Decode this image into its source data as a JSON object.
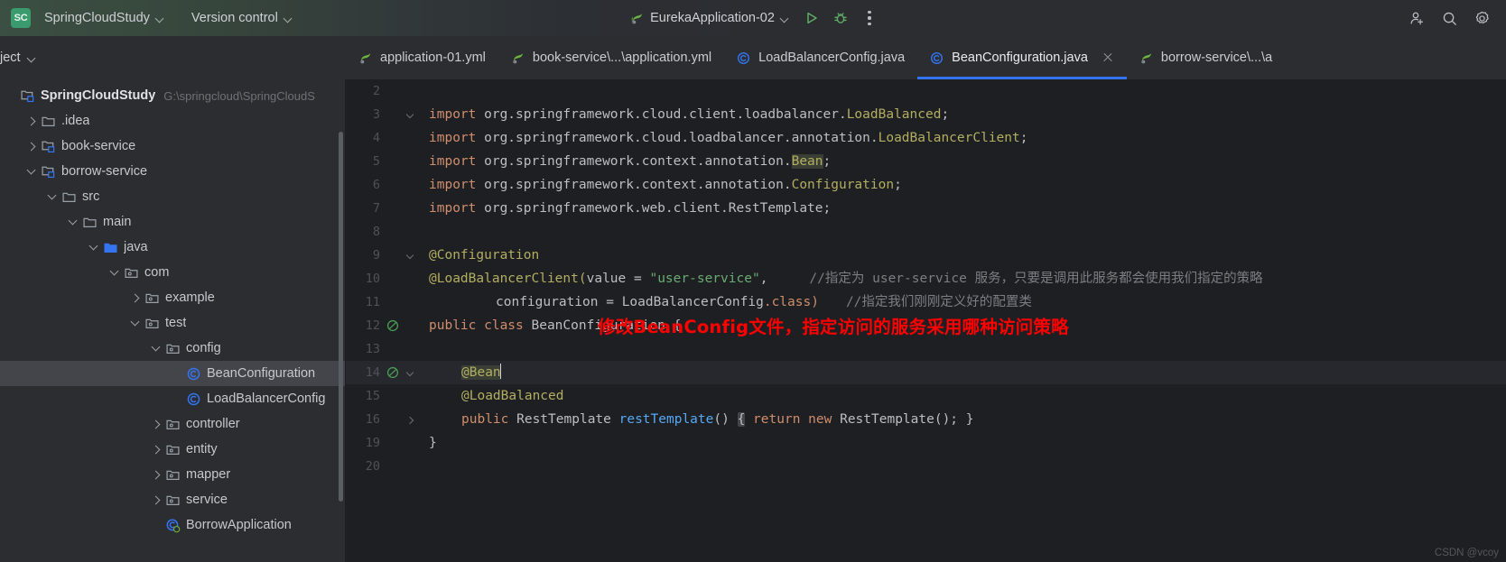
{
  "titlebar": {
    "badge": "SC",
    "project_name": "SpringCloudStudy",
    "version_control": "Version control",
    "run_config": "EurekaApplication-02",
    "icons": {
      "run": "run-icon",
      "debug": "debug-icon",
      "more": "more-options-icon",
      "add_user": "add-user-icon",
      "search": "search-icon",
      "settings": "settings-icon"
    },
    "accent_run": "#5fad65",
    "accent_debug": "#5fad65"
  },
  "sidebar": {
    "header": "ject",
    "tree": [
      {
        "label": "SpringCloudStudy",
        "path": "G:\\springcloud\\SpringCloudS",
        "indent": 0,
        "arrow": "none",
        "icon": "module-folder-icon",
        "root": true,
        "selected": false
      },
      {
        "label": ".idea",
        "path": "",
        "indent": 1,
        "arrow": "right",
        "icon": "folder-icon",
        "root": false,
        "selected": false
      },
      {
        "label": "book-service",
        "path": "",
        "indent": 1,
        "arrow": "right",
        "icon": "module-folder-icon",
        "root": false,
        "selected": false
      },
      {
        "label": "borrow-service",
        "path": "",
        "indent": 1,
        "arrow": "down",
        "icon": "module-folder-icon",
        "root": false,
        "selected": false
      },
      {
        "label": "src",
        "path": "",
        "indent": 2,
        "arrow": "down",
        "icon": "folder-icon",
        "root": false,
        "selected": false
      },
      {
        "label": "main",
        "path": "",
        "indent": 3,
        "arrow": "down",
        "icon": "folder-icon",
        "root": false,
        "selected": false
      },
      {
        "label": "java",
        "path": "",
        "indent": 4,
        "arrow": "down",
        "icon": "source-folder-icon",
        "root": false,
        "selected": false
      },
      {
        "label": "com",
        "path": "",
        "indent": 5,
        "arrow": "down",
        "icon": "package-icon",
        "root": false,
        "selected": false
      },
      {
        "label": "example",
        "path": "",
        "indent": 6,
        "arrow": "right",
        "icon": "package-icon",
        "root": false,
        "selected": false
      },
      {
        "label": "test",
        "path": "",
        "indent": 6,
        "arrow": "down",
        "icon": "package-icon",
        "root": false,
        "selected": false
      },
      {
        "label": "config",
        "path": "",
        "indent": 7,
        "arrow": "down",
        "icon": "package-icon",
        "root": false,
        "selected": false
      },
      {
        "label": "BeanConfiguration",
        "path": "",
        "indent": 8,
        "arrow": "none",
        "icon": "java-class-icon",
        "root": false,
        "selected": true
      },
      {
        "label": "LoadBalancerConfig",
        "path": "",
        "indent": 8,
        "arrow": "none",
        "icon": "java-class-icon",
        "root": false,
        "selected": false
      },
      {
        "label": "controller",
        "path": "",
        "indent": 7,
        "arrow": "right",
        "icon": "package-icon",
        "root": false,
        "selected": false
      },
      {
        "label": "entity",
        "path": "",
        "indent": 7,
        "arrow": "right",
        "icon": "package-icon",
        "root": false,
        "selected": false
      },
      {
        "label": "mapper",
        "path": "",
        "indent": 7,
        "arrow": "right",
        "icon": "package-icon",
        "root": false,
        "selected": false
      },
      {
        "label": "service",
        "path": "",
        "indent": 7,
        "arrow": "right",
        "icon": "package-icon",
        "root": false,
        "selected": false
      },
      {
        "label": "BorrowApplication",
        "path": "",
        "indent": 7,
        "arrow": "none",
        "icon": "spring-class-icon",
        "root": false,
        "selected": false
      }
    ]
  },
  "tabs": [
    {
      "label": "application-01.yml",
      "icon": "spring-yaml-icon",
      "active": false,
      "closable": false
    },
    {
      "label": "book-service\\...\\application.yml",
      "icon": "spring-yaml-icon",
      "active": false,
      "closable": false
    },
    {
      "label": "LoadBalancerConfig.java",
      "icon": "java-class-icon",
      "active": false,
      "closable": false
    },
    {
      "label": "BeanConfiguration.java",
      "icon": "java-class-icon",
      "active": true,
      "closable": true
    },
    {
      "label": "borrow-service\\...\\a",
      "icon": "spring-yaml-icon",
      "active": false,
      "closable": false
    }
  ],
  "editor": {
    "line_numbers": [
      "2",
      "3",
      "4",
      "5",
      "6",
      "7",
      "8",
      "9",
      "10",
      "11",
      "12",
      "13",
      "14",
      "15",
      "16",
      "19",
      "20"
    ],
    "gutter_marks": {
      "12": "bean-gutter-icon",
      "14": "bean-gutter-icon"
    },
    "fold_markers": {
      "3": "down",
      "9": "down",
      "14": "down",
      "16": "right"
    },
    "caret_line": "14",
    "annotation_overlay": "修改BeanConfig文件，指定访问的服务采用哪种访问策略",
    "annotation_color": "#ff0000",
    "code": {
      "l2": "",
      "l3_import": "import",
      "l3_pkg": " org.springframework.cloud.client.loadbalancer.",
      "l3_type": "LoadBalanced",
      "l4_import": "import",
      "l4_pkg": " org.springframework.cloud.loadbalancer.annotation.",
      "l4_type": "LoadBalancerClient",
      "l5_import": "import",
      "l5_pkg": " org.springframework.context.annotation.",
      "l5_type": "Bean",
      "l6_import": "import",
      "l6_pkg": " org.springframework.context.annotation.",
      "l6_type": "Configuration",
      "l7_import": "import",
      "l7_pkg": " org.springframework.web.client.",
      "l7_type": "RestTemplate",
      "l9": "@Configuration",
      "l10_ann": "@LoadBalancerClient(",
      "l10_param": "value",
      "l10_eq": " = ",
      "l10_str": "\"user-service\"",
      "l10_tail": ",",
      "l10_comment": "//指定为 user-service 服务，只要是调用此服务都会使用我们指定的策略",
      "l11_param": "configuration",
      "l11_eq": " = ",
      "l11_type": "LoadBalancerConfig",
      "l11_dot_class": ".class)",
      "l11_comment": "//指定我们刚刚定义好的配置类",
      "l12_kw": "public class",
      "l12_name": " BeanConfiguration ",
      "l12_brace": "{",
      "l13": "",
      "l14": "@Bean",
      "l15": "@LoadBalanced",
      "l16_kw": "public",
      "l16_type": " RestTemplate ",
      "l16_method": "restTemplate",
      "l16_parens": "()",
      "l16_fold_open": "{",
      "l16_ret": "return",
      "l16_new": " new ",
      "l16_newtype": "RestTemplate();",
      "l16_fold_close": "}",
      "l19": "}",
      "l20": ""
    }
  },
  "watermark": "CSDN @vcoy"
}
